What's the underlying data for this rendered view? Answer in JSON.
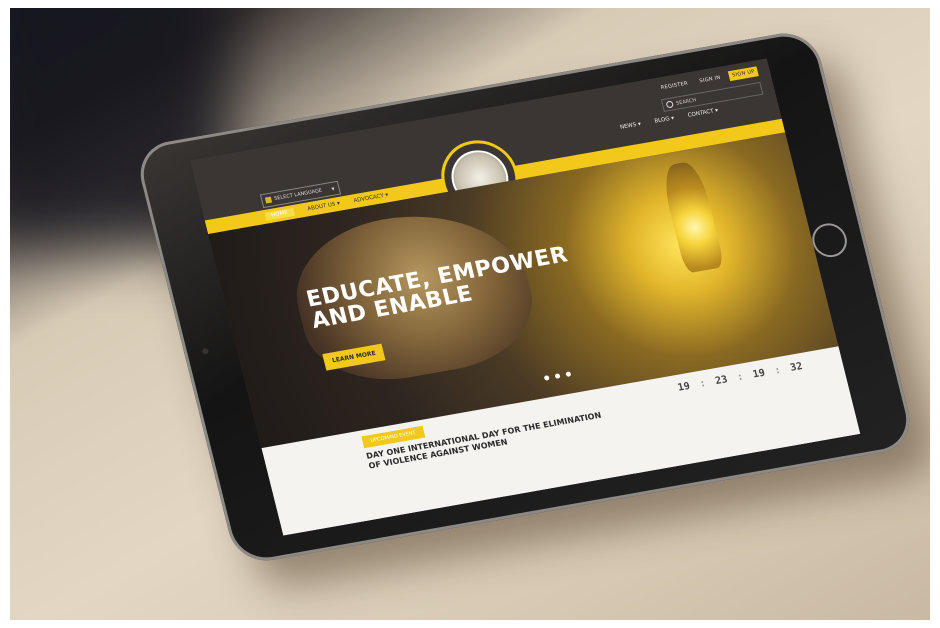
{
  "header": {
    "auth": {
      "register": "REGISTER",
      "signin": "SIGN IN",
      "signup": "SIGN UP"
    },
    "search_placeholder": "SEARCH",
    "language": "SELECT LANGUAGE"
  },
  "nav": {
    "left": [
      "HOME",
      "ABOUT US ▾",
      "ADVOCACY ▾"
    ],
    "right": [
      "NEWS ▾",
      "BLOG ▾",
      "CONTACT ▾"
    ]
  },
  "hero": {
    "title_line1": "EDUCATE, EMPOWER",
    "title_line2": "AND ENABLE",
    "cta": "LEARN MORE"
  },
  "countdown": {
    "days": "19",
    "hours": "23",
    "minutes": "19",
    "seconds": "32",
    "separator": ":"
  },
  "event": {
    "badge": "UPCOMING EVENT",
    "title": "DAY ONE INTERNATIONAL DAY FOR THE ELIMINATION OF VIOLENCE AGAINST WOMEN"
  },
  "colors": {
    "accent": "#f2c91a",
    "header_bg": "#3b3533"
  }
}
